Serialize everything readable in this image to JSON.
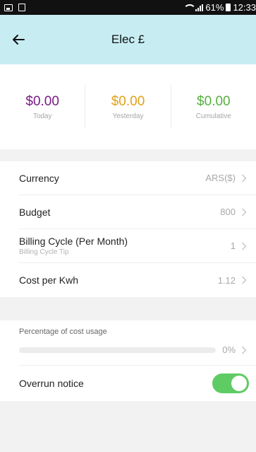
{
  "status_bar": {
    "battery": "61%",
    "time": "12:33"
  },
  "header": {
    "title": "Elec £"
  },
  "stats": [
    {
      "value": "$0.00",
      "label": "Today",
      "color": "#7a1a86"
    },
    {
      "value": "$0.00",
      "label": "Yesterday",
      "color": "#e3a11a"
    },
    {
      "value": "$0.00",
      "label": "Cumulative",
      "color": "#55b03e"
    }
  ],
  "settings": {
    "currency": {
      "label": "Currency",
      "value": "ARS($)"
    },
    "budget": {
      "label": "Budget",
      "value": "800"
    },
    "billing_cycle": {
      "label": "Billing Cycle (Per Month)",
      "sub": "Billing Cycle Tip",
      "value": "1"
    },
    "cost_per_kwh": {
      "label": "Cost per Kwh",
      "value": "1.12"
    }
  },
  "usage": {
    "label": "Percentage of cost usage",
    "value": "0%",
    "fraction": 0
  },
  "overrun": {
    "label": "Overrun notice",
    "enabled": true
  },
  "icons": {
    "back": "arrow-left-icon",
    "chevron": "chevron-right-icon"
  }
}
